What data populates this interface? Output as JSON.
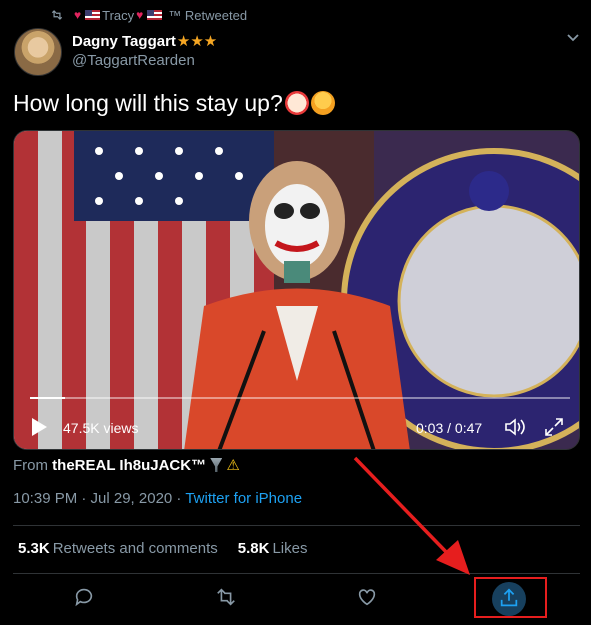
{
  "retweet_bar": {
    "hearts_left": "♥",
    "user": "Tracy",
    "hearts_right": "♥",
    "suffix": "™ Retweeted"
  },
  "author": {
    "display_name": "Dagny Taggart",
    "stars": "★★★",
    "handle": "@TaggartRearden"
  },
  "tweet": {
    "text": "How long will this stay up?"
  },
  "video": {
    "views_label": "47.5K views",
    "time_label": "0:03 / 0:47",
    "progress_fraction": 0.064
  },
  "source": {
    "prefix": "From",
    "account": "theREAL Ih8uJACK™",
    "warning": "⚠"
  },
  "meta": {
    "time": "10:39 PM · Jul 29, 2020 · ",
    "app": "Twitter for iPhone"
  },
  "stats": {
    "retweets_count": "5.3K",
    "retweets_label": "Retweets and comments",
    "likes_count": "5.8K",
    "likes_label": "Likes"
  },
  "colors": {
    "background": "#000000",
    "accent": "#1da1f2",
    "annotation_red": "#e61e1e",
    "muted": "#8899a6"
  },
  "icons": [
    "retweet-icon",
    "chevron-down-icon",
    "play-icon",
    "volume-icon",
    "fullscreen-icon",
    "reply-icon",
    "retweet-action-icon",
    "like-icon",
    "share-icon"
  ]
}
